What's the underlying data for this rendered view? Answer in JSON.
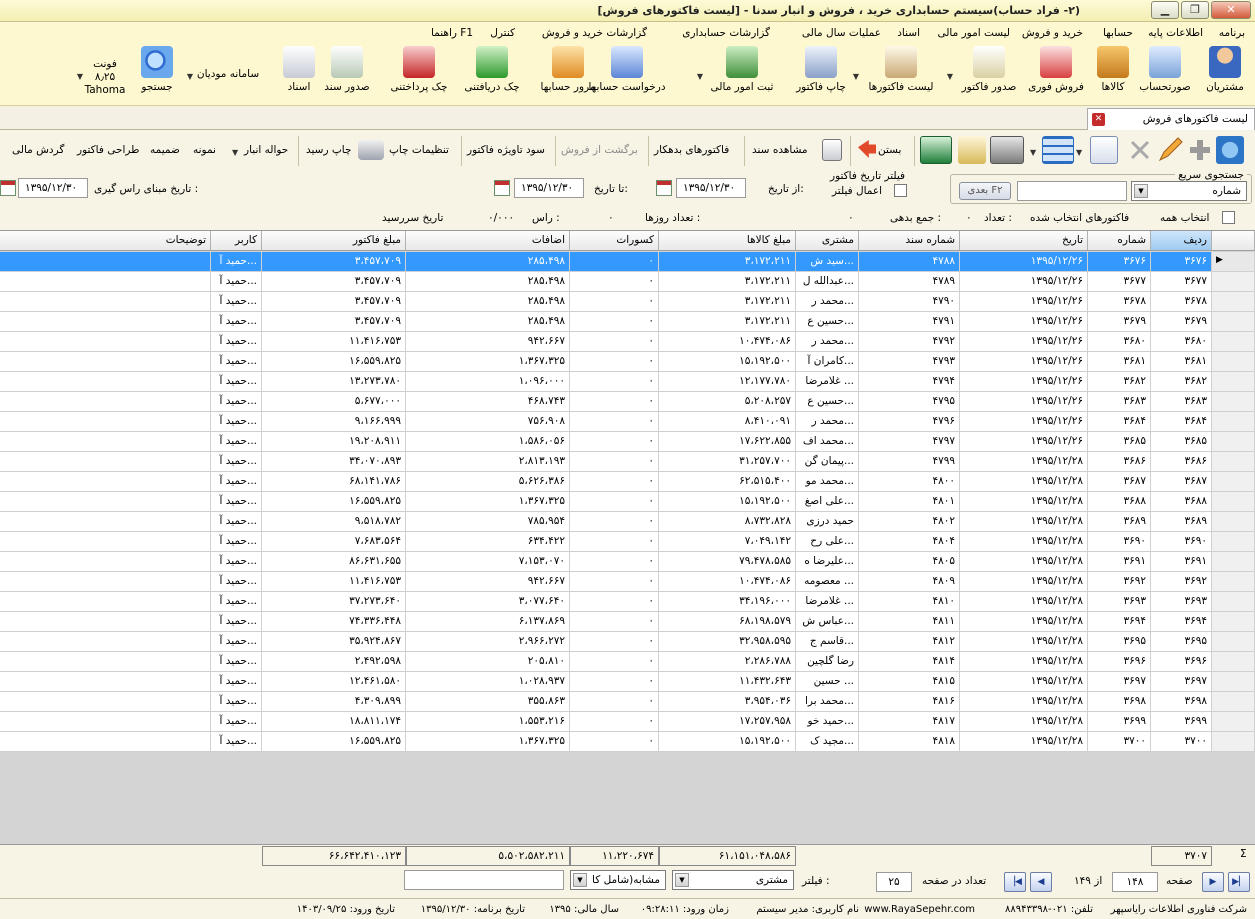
{
  "window": {
    "title": "(۲- فراد حساب)سیستم حسابداری خرید ، فروش و انبار سدنا - [لیست فاکتورهای فروش]"
  },
  "menu": [
    "برنامه",
    "اطلاعات پایه",
    "حسابها",
    "خرید و فروش",
    "لیست امور مالی",
    "اسناد",
    "عملیات سال مالی",
    "گزارشات حسابداری",
    "گزارشات خرید و فروش",
    "کنترل",
    "راهنما F1"
  ],
  "ribbon": {
    "customers": "مشتریان",
    "statements": "صورتحساب",
    "goods": "کالاها",
    "quick_sale": "فروش فوری",
    "issue_invoice": "صدور فاکتور",
    "invoice_list": "لیست فاکتورها",
    "print_invoice": "چاپ فاکتور",
    "record_finance": "ثبت امور مالی",
    "account_request": "درخواست حسابها",
    "account_review": "مرور حسابها",
    "received_check": "چک دریافتنی",
    "paid_check": "چک پرداختنی",
    "issue_doc": "صدور سند",
    "documents": "اسناد",
    "taxpayer_system": "سامانه مودیان",
    "search": "جستجو",
    "font_label": "فونت",
    "font_size": "۸٫۲۵",
    "font_name": "Tahoma"
  },
  "tab": {
    "label": "لیست فاکتورهای فروش"
  },
  "toolbar": {
    "close": "بستن",
    "view_doc": "مشاهده سند",
    "debtor_invoices": "فاکتورهای بدهکار",
    "sales_return": "برگشت از فروش",
    "invoice_profit": "سود تاویژه فاکتور",
    "print_settings": "تنظیمات چاپ",
    "print_receipt": "چاپ رسید",
    "warehouse_transfer": "حواله انبار",
    "sample": "نمونه",
    "attachment": "ضمیمه",
    "invoice_design": "طراحی فاکتور",
    "financial_flow": "گردش مالی"
  },
  "filters": {
    "quick_search_label": "جستجوی سریع",
    "quick_search_field": "شماره",
    "next_button": "بعدی F۲",
    "date_filter_title": "فیلتر تاریخ فاکتور",
    "apply_filter": "اعمال فیلتر",
    "from_label": "از تاریخ:",
    "from_date": "۱۳۹۵/۱۲/۳۰",
    "to_label": "تا تاریخ:",
    "to_date": "۱۳۹۵/۱۲/۳۰",
    "base_date_label": "تاریخ مبنای راس گیری :",
    "base_date": "۱۳۹۵/۱۲/۳۰"
  },
  "summary": {
    "select_all": "انتخاب همه",
    "selected_invoices": "فاکتورهای انتخاب شده",
    "count_label": "تعداد :",
    "count": "۰",
    "debt_sum_label": "جمع بدهی :",
    "debt_sum": "۰",
    "days_label": "تعداد روزها :",
    "days": "۰",
    "ras_label": "راس :",
    "ras": "۰/۰۰۰",
    "due_date_label": "تاریخ سررسید"
  },
  "table": {
    "columns": [
      "ردیف",
      "شماره",
      "تاریخ",
      "شماره سند",
      "مشتری",
      "مبلغ کالاها",
      "کسورات",
      "اضافات",
      "مبلغ فاکتور",
      "کاربر",
      "توضیحات"
    ],
    "rows": [
      [
        "۳۶۷۶",
        "۳۶۷۶",
        "۱۳۹۵/۱۲/۲۶",
        "۴۷۸۸",
        "سید ش...",
        "۳،۱۷۲،۲۱۱",
        "۰",
        "۲۸۵،۴۹۸",
        "۳،۴۵۷،۷۰۹",
        "حمید آ...",
        ""
      ],
      [
        "۳۶۷۷",
        "۳۶۷۷",
        "۱۳۹۵/۱۲/۲۶",
        "۴۷۸۹",
        "عبدالله ل...",
        "۳،۱۷۲،۲۱۱",
        "۰",
        "۲۸۵،۴۹۸",
        "۳،۴۵۷،۷۰۹",
        "حمید آ...",
        ""
      ],
      [
        "۳۶۷۸",
        "۳۶۷۸",
        "۱۳۹۵/۱۲/۲۶",
        "۴۷۹۰",
        "محمد ر...",
        "۳،۱۷۲،۲۱۱",
        "۰",
        "۲۸۵،۴۹۸",
        "۳،۴۵۷،۷۰۹",
        "حمید آ...",
        ""
      ],
      [
        "۳۶۷۹",
        "۳۶۷۹",
        "۱۳۹۵/۱۲/۲۶",
        "۴۷۹۱",
        "حسین ع...",
        "۳،۱۷۲،۲۱۱",
        "۰",
        "۲۸۵،۴۹۸",
        "۳،۴۵۷،۷۰۹",
        "حمید آ...",
        ""
      ],
      [
        "۳۶۸۰",
        "۳۶۸۰",
        "۱۳۹۵/۱۲/۲۶",
        "۴۷۹۲",
        "محمد ر...",
        "۱۰،۴۷۴،۰۸۶",
        "۰",
        "۹۴۲،۶۶۷",
        "۱۱،۴۱۶،۷۵۳",
        "حمید آ...",
        ""
      ],
      [
        "۳۶۸۱",
        "۳۶۸۱",
        "۱۳۹۵/۱۲/۲۶",
        "۴۷۹۳",
        "کامران آ...",
        "۱۵،۱۹۲،۵۰۰",
        "۰",
        "۱،۳۶۷،۳۲۵",
        "۱۶،۵۵۹،۸۲۵",
        "حمید آ...",
        ""
      ],
      [
        "۳۶۸۲",
        "۳۶۸۲",
        "۱۳۹۵/۱۲/۲۶",
        "۴۷۹۴",
        "غلامرضا ...",
        "۱۲،۱۷۷،۷۸۰",
        "۰",
        "۱،۰۹۶،۰۰۰",
        "۱۳،۲۷۳،۷۸۰",
        "حمید آ...",
        ""
      ],
      [
        "۳۶۸۳",
        "۳۶۸۳",
        "۱۳۹۵/۱۲/۲۶",
        "۴۷۹۵",
        "حسین ع...",
        "۵،۲۰۸،۲۵۷",
        "۰",
        "۴۶۸،۷۴۳",
        "۵،۶۷۷،۰۰۰",
        "حمید آ...",
        ""
      ],
      [
        "۳۶۸۴",
        "۳۶۸۴",
        "۱۳۹۵/۱۲/۲۶",
        "۴۷۹۶",
        "محمد ر...",
        "۸،۴۱۰،۰۹۱",
        "۰",
        "۷۵۶،۹۰۸",
        "۹،۱۶۶،۹۹۹",
        "حمید آ...",
        ""
      ],
      [
        "۳۶۸۵",
        "۳۶۸۵",
        "۱۳۹۵/۱۲/۲۶",
        "۴۷۹۷",
        "محمد اف...",
        "۱۷،۶۲۲،۸۵۵",
        "۰",
        "۱،۵۸۶،۰۵۶",
        "۱۹،۲۰۸،۹۱۱",
        "حمید آ...",
        ""
      ],
      [
        "۳۶۸۶",
        "۳۶۸۶",
        "۱۳۹۵/۱۲/۲۸",
        "۴۷۹۹",
        "پیمان گن...",
        "۳۱،۲۵۷،۷۰۰",
        "۰",
        "۲،۸۱۳،۱۹۳",
        "۳۴،۰۷۰،۸۹۳",
        "حمید آ...",
        ""
      ],
      [
        "۳۶۸۷",
        "۳۶۸۷",
        "۱۳۹۵/۱۲/۲۸",
        "۴۸۰۰",
        "محمد مو...",
        "۶۲،۵۱۵،۴۰۰",
        "۰",
        "۵،۶۲۶،۳۸۶",
        "۶۸،۱۴۱،۷۸۶",
        "حمید آ...",
        ""
      ],
      [
        "۳۶۸۸",
        "۳۶۸۸",
        "۱۳۹۵/۱۲/۲۸",
        "۴۸۰۱",
        "علی اصغ...",
        "۱۵،۱۹۲،۵۰۰",
        "۰",
        "۱،۳۶۷،۳۲۵",
        "۱۶،۵۵۹،۸۲۵",
        "حمید آ...",
        ""
      ],
      [
        "۳۶۸۹",
        "۳۶۸۹",
        "۱۳۹۵/۱۲/۲۸",
        "۴۸۰۲",
        "حمید درزی",
        "۸،۷۳۲،۸۲۸",
        "۰",
        "۷۸۵،۹۵۴",
        "۹،۵۱۸،۷۸۲",
        "حمید آ...",
        ""
      ],
      [
        "۳۶۹۰",
        "۳۶۹۰",
        "۱۳۹۵/۱۲/۲۸",
        "۴۸۰۴",
        "علی رح...",
        "۷،۰۴۹،۱۴۲",
        "۰",
        "۶۳۴،۴۲۲",
        "۷،۶۸۳،۵۶۴",
        "حمید آ...",
        ""
      ],
      [
        "۳۶۹۱",
        "۳۶۹۱",
        "۱۳۹۵/۱۲/۲۸",
        "۴۸۰۵",
        "علیرضا ه...",
        "۷۹،۴۷۸،۵۸۵",
        "۰",
        "۷،۱۵۳،۰۷۰",
        "۸۶،۶۳۱،۶۵۵",
        "حمید آ...",
        ""
      ],
      [
        "۳۶۹۲",
        "۳۶۹۲",
        "۱۳۹۵/۱۲/۲۸",
        "۴۸۰۹",
        "معصومه ...",
        "۱۰،۴۷۴،۰۸۶",
        "۰",
        "۹۴۲،۶۶۷",
        "۱۱،۴۱۶،۷۵۳",
        "حمید آ...",
        ""
      ],
      [
        "۳۶۹۳",
        "۳۶۹۳",
        "۱۳۹۵/۱۲/۲۸",
        "۴۸۱۰",
        "غلامرضا ...",
        "۳۴،۱۹۶،۰۰۰",
        "۰",
        "۳،۰۷۷،۶۴۰",
        "۳۷،۲۷۳،۶۴۰",
        "حمید آ...",
        ""
      ],
      [
        "۳۶۹۴",
        "۳۶۹۴",
        "۱۳۹۵/۱۲/۲۸",
        "۴۸۱۱",
        "عباس ش...",
        "۶۸،۱۹۸،۵۷۹",
        "۰",
        "۶،۱۳۷،۸۶۹",
        "۷۴،۳۳۶،۴۴۸",
        "حمید آ...",
        ""
      ],
      [
        "۳۶۹۵",
        "۳۶۹۵",
        "۱۳۹۵/۱۲/۲۸",
        "۴۸۱۲",
        "قاسم ج...",
        "۳۲،۹۵۸،۵۹۵",
        "۰",
        "۲،۹۶۶،۲۷۲",
        "۳۵،۹۲۴،۸۶۷",
        "حمید آ...",
        ""
      ],
      [
        "۳۶۹۶",
        "۳۶۹۶",
        "۱۳۹۵/۱۲/۲۸",
        "۴۸۱۴",
        "رضا گلچین",
        "۲،۲۸۶،۷۸۸",
        "۰",
        "۲۰۵،۸۱۰",
        "۲،۴۹۲،۵۹۸",
        "حمید آ...",
        ""
      ],
      [
        "۳۶۹۷",
        "۳۶۹۷",
        "۱۳۹۵/۱۲/۲۸",
        "۴۸۱۵",
        "حسین ...",
        "۱۱،۴۳۲،۶۴۳",
        "۰",
        "۱،۰۲۸،۹۳۷",
        "۱۲،۴۶۱،۵۸۰",
        "حمید آ...",
        ""
      ],
      [
        "۳۶۹۸",
        "۳۶۹۸",
        "۱۳۹۵/۱۲/۲۸",
        "۴۸۱۶",
        "محمد برا...",
        "۳،۹۵۴،۰۳۶",
        "۰",
        "۳۵۵،۸۶۳",
        "۴،۳۰۹،۸۹۹",
        "حمید آ...",
        ""
      ],
      [
        "۳۶۹۹",
        "۳۶۹۹",
        "۱۳۹۵/۱۲/۲۸",
        "۴۸۱۷",
        "حمید خو...",
        "۱۷،۲۵۷،۹۵۸",
        "۰",
        "۱،۵۵۳،۲۱۶",
        "۱۸،۸۱۱،۱۷۴",
        "حمید آ...",
        ""
      ],
      [
        "۳۷۰۰",
        "۳۷۰۰",
        "۱۳۹۵/۱۲/۲۸",
        "۴۸۱۸",
        "مجید ک...",
        "۱۵،۱۹۲،۵۰۰",
        "۰",
        "۱،۳۶۷،۳۲۵",
        "۱۶،۵۵۹،۸۲۵",
        "حمید آ...",
        ""
      ]
    ]
  },
  "totals": {
    "count": "۳۷۰۷",
    "goods": "۶۱،۱۵۱،۰۴۸،۵۸۶",
    "deductions": "۱۱،۲۲۰،۶۷۴",
    "additions": "۵،۵۰۲،۵۸۲،۲۱۱",
    "invoice": "۶۶،۶۴۲،۴۱۰،۱۲۳"
  },
  "pager": {
    "page_label": "صفحه",
    "page": "۱۴۸",
    "of_label": "از ۱۴۹",
    "per_page_label": "تعداد در صفحه",
    "per_page": "۲۵",
    "filter_label": "فیلتر :",
    "filter_field": "مشتری",
    "filter_mode": "مشابه(شامل کا"
  },
  "status": {
    "company": "شرکت فناوری اطلاعات رایاسپهر",
    "phone": "تلفن: ۰۲۱-۸۸۹۴۳۳۹۸",
    "url": "www.RayaSepehr.com",
    "user": "نام کاربری: مدیر سیستم",
    "login_time": "زمان ورود: ۰۹:۲۸:۱۱",
    "fiscal_year": "سال مالی: ۱۳۹۵",
    "program_date": "تاریخ برنامه: ۱۳۹۵/۱۲/۳۰",
    "login_date": "تاریخ ورود: ۱۴۰۳/۰۹/۲۵"
  },
  "colors": {
    "accent": "#3399ff",
    "window_bg": "#fdf8cf"
  }
}
